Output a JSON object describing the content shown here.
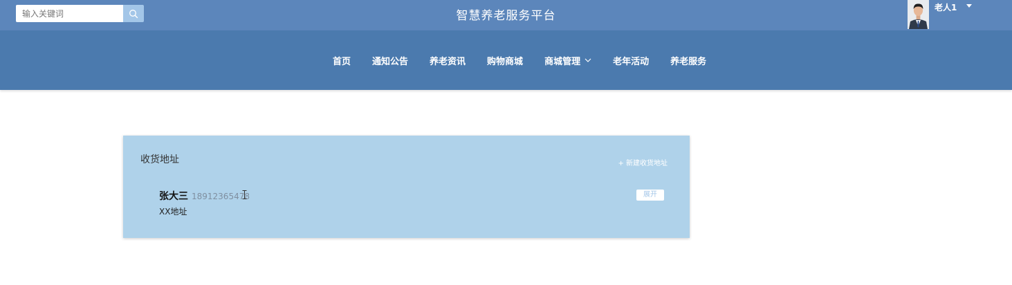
{
  "header": {
    "search": {
      "placeholder": "输入关键词",
      "value": ""
    },
    "title": "智慧养老服务平台",
    "user": {
      "name": "老人1"
    }
  },
  "nav": {
    "items": [
      {
        "label": "首页"
      },
      {
        "label": "通知公告"
      },
      {
        "label": "养老资讯"
      },
      {
        "label": "购物商城"
      },
      {
        "label": "商城管理",
        "has_dropdown": true
      },
      {
        "label": "老年活动"
      },
      {
        "label": "养老服务"
      }
    ]
  },
  "address_card": {
    "title": "收货地址",
    "new_address_label": "+ 新建收货地址",
    "entry": {
      "name": "张大三",
      "phone": "18912365478",
      "address": "XX地址",
      "expand_label": "展开"
    }
  },
  "colors": {
    "topbar": "#5c86bb",
    "navbar": "#4b7aae",
    "card": "#afd2ea",
    "search_button": "#a3c6e8"
  },
  "icons": [
    "search-icon",
    "user-caret-icon",
    "chevron-down-icon",
    "text-cursor-icon"
  ]
}
